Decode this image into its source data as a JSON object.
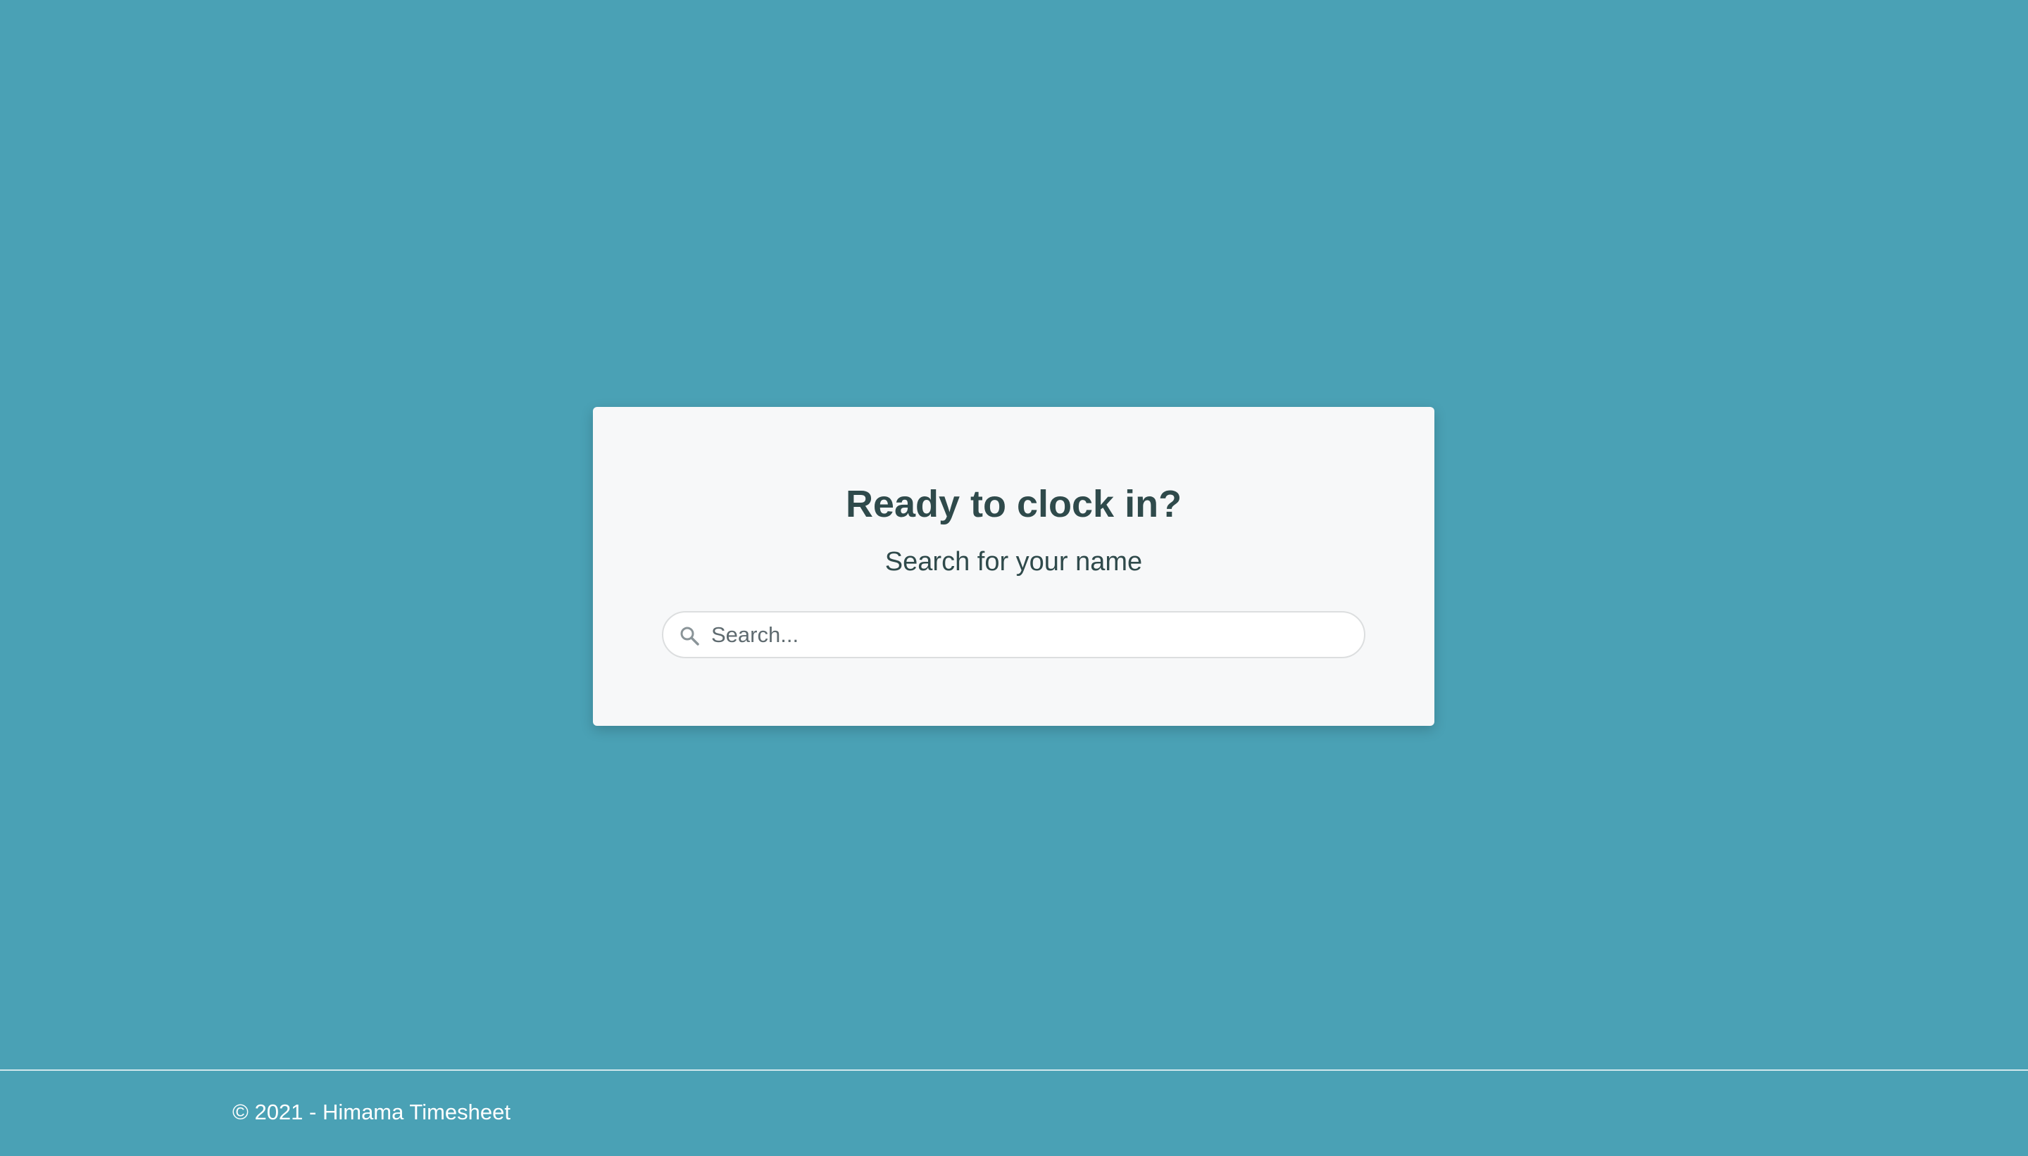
{
  "colors": {
    "page_background": "#4aa1b5",
    "card_background": "#f7f8f9",
    "heading_text": "#2f4a4b",
    "footer_text": "#ffffff"
  },
  "card": {
    "title": "Ready to clock in?",
    "subtitle": "Search for your name",
    "search": {
      "icon": "search-icon",
      "placeholder": "Search...",
      "value": ""
    }
  },
  "footer": {
    "text": "© 2021 - Himama Timesheet"
  }
}
